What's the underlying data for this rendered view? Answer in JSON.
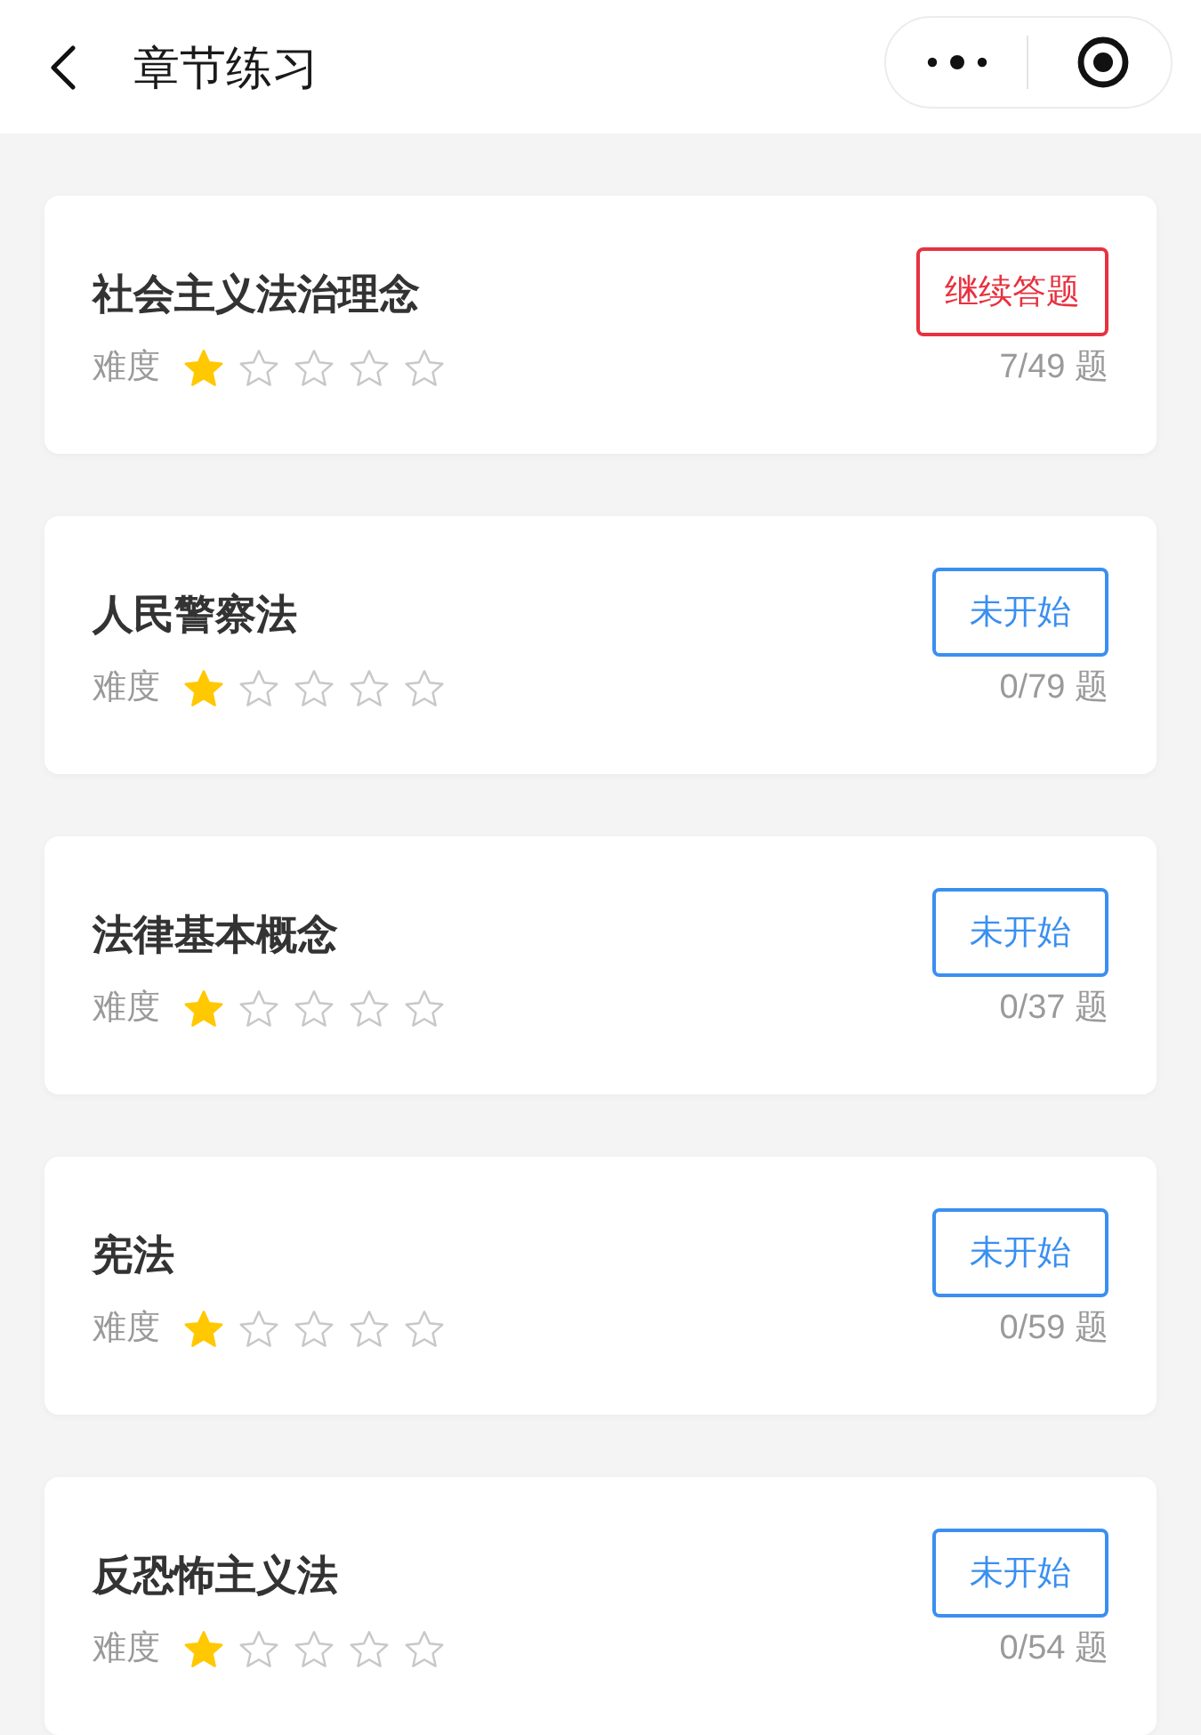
{
  "header": {
    "title": "章节练习"
  },
  "chapters": [
    {
      "title": "社会主义法治理念",
      "difficulty_label": "难度",
      "stars": 1,
      "button": {
        "label": "继续答题",
        "kind": "continue"
      },
      "progress": "7/49 题"
    },
    {
      "title": "人民警察法",
      "difficulty_label": "难度",
      "stars": 1,
      "button": {
        "label": "未开始",
        "kind": "not_started"
      },
      "progress": "0/79 题"
    },
    {
      "title": "法律基本概念",
      "difficulty_label": "难度",
      "stars": 1,
      "button": {
        "label": "未开始",
        "kind": "not_started"
      },
      "progress": "0/37 题"
    },
    {
      "title": "宪法",
      "difficulty_label": "难度",
      "stars": 1,
      "button": {
        "label": "未开始",
        "kind": "not_started"
      },
      "progress": "0/59 题"
    },
    {
      "title": "反恐怖主义法",
      "difficulty_label": "难度",
      "stars": 1,
      "button": {
        "label": "未开始",
        "kind": "not_started"
      },
      "progress": "0/54 题"
    }
  ]
}
